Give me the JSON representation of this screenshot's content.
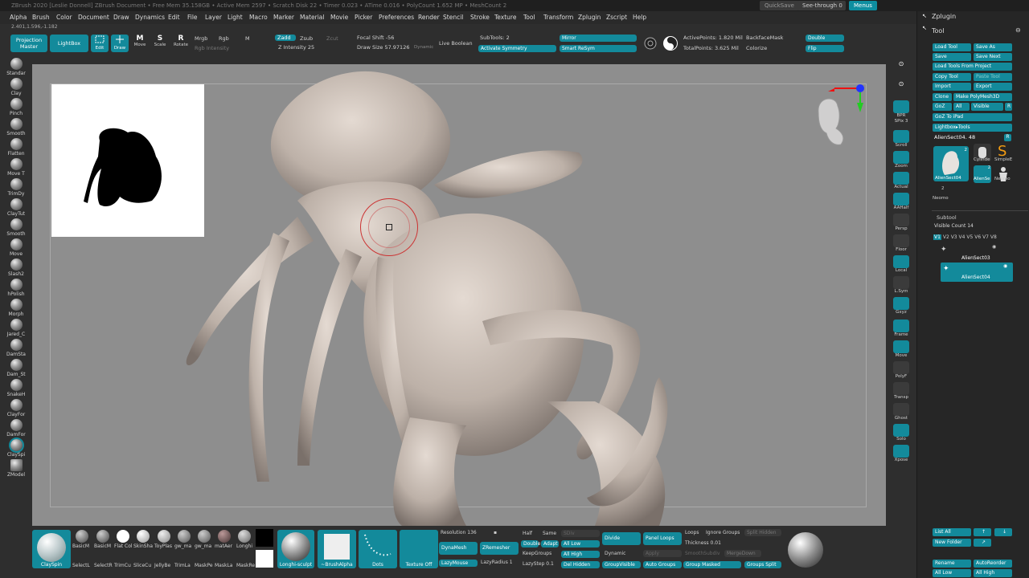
{
  "titlebar": {
    "text": "ZBrush 2020 [Leslie Donnell] ZBrush Document  •  Free Mem 35.158GB  •  Active Mem 2597  •  Scratch Disk 22  •  Timer 0.023  •  ATime 0.016  •  PolyCount 1.652 MP  •  MeshCount 2",
    "quicksave": "QuickSave",
    "see_through": "See-through",
    "see_through_value": "0",
    "menus": "Menus"
  },
  "menubar": [
    "Alpha",
    "Brush",
    "Color",
    "Document",
    "Draw",
    "Dynamics",
    "Edit",
    "File",
    "Layer",
    "Light",
    "Macro",
    "Marker",
    "Material",
    "Movie",
    "Picker",
    "Preferences",
    "Render",
    "Stencil",
    "Stroke",
    "Texture",
    "Tool",
    "Transform",
    "Zplugin",
    "Zscript",
    "Help"
  ],
  "coords": "2.401,1.596,-1.182",
  "toolbar": {
    "projection_master": "Projection Master",
    "lightbox": "LightBox",
    "edit": "Edit",
    "draw": "Draw",
    "move": "Move",
    "scale": "Scale",
    "rotate": "Rotate",
    "mrgb": "Mrgb",
    "rgb": "Rgb",
    "m": "M",
    "rgb_intensity": "Rgb Intensity",
    "zadd": "Zadd",
    "zsub": "Zsub",
    "zcut": "Zcut",
    "z_intensity": "Z Intensity 25",
    "focal_shift": "Focal Shift -56",
    "draw_size": "Draw Size 57.97126",
    "dynamic": "Dynamic",
    "live_boolean": "Live Boolean",
    "subtools": "SubTools: 2",
    "activate_symmetry": "Activate Symmetry",
    "mirror": "Mirror",
    "smart_resym": "Smart ReSym",
    "active_points": "ActivePoints: 1.820 Mil",
    "total_points": "TotalPoints: 3.625 Mil",
    "backface_mask": "BackfaceMask",
    "colorize": "Colorize",
    "double": "Double",
    "flip": "Flip"
  },
  "left_brushes": [
    "Standar",
    "Clay",
    "Pinch",
    "Smooth",
    "Flatten",
    "Move T",
    "TrimDy",
    "ClayTut",
    "Smooth",
    "Move",
    "Slash2",
    "hPolish",
    "Morph",
    "Jared_C",
    "DamSta",
    "Dam_St",
    "SnakeH",
    "ClayFor",
    "DamFor",
    "ClaySpi",
    "ZModel"
  ],
  "right_shelf": [
    "BPR",
    "SPix 3",
    "Scroll",
    "Zoom",
    "Actual",
    "AAHalf",
    "Persp",
    "Floor",
    "Local",
    "L.Sym",
    "Gxyz",
    "",
    "Frame",
    "Move",
    "Zoom3D",
    "PolyF",
    "Transp",
    "Ghost",
    "Solo",
    "Xpose"
  ],
  "tray": {
    "zplugin": "Zplugin",
    "tool": "Tool",
    "buttons": [
      [
        "Load Tool",
        "Save As"
      ],
      [
        "Save",
        "Save Next"
      ],
      [
        "Load Tools From Project"
      ],
      [
        "Copy Tool",
        "Paste Tool"
      ],
      [
        "Import",
        "Export"
      ],
      [
        "Clone",
        "Make PolyMesh3D"
      ],
      [
        "GoZ",
        "All",
        "Visible",
        "R"
      ],
      [
        "GoZ To iPad"
      ],
      [
        "Lightbox▸Tools"
      ]
    ],
    "current_tool": "AlienSect04. 48",
    "r_label": "R",
    "thumb_labels": [
      "AlienSect04",
      "Cylinde",
      "SimpleE",
      "AlienSe",
      "Neomo",
      "Neomo"
    ],
    "thumb_counts": [
      "2",
      "2",
      "2"
    ],
    "subtool": "Subtool",
    "visible_count": "Visible Count 14",
    "versions": [
      "V1",
      "V2",
      "V3",
      "V4",
      "V5",
      "V6",
      "V7",
      "V8"
    ],
    "subtools": [
      "AlienSect03",
      "AlienSect04"
    ],
    "bottom_buttons": [
      [
        "List All",
        "↑",
        "↓"
      ],
      [
        "New Folder",
        "↗"
      ],
      [
        "Rename",
        "AutoReorder"
      ],
      [
        "All Low",
        "All High"
      ]
    ]
  },
  "bottom": {
    "current_brush": "ClaySpin",
    "brushes": [
      "BasicM",
      "BasicM",
      "Flat Col",
      "SkinSha",
      "ToyPlas",
      "gw_ma",
      "gw_ma",
      "matAer",
      "Longhi"
    ],
    "brushes2": [
      "SelectL",
      "SelectR",
      "TrimCu",
      "SliceCu",
      "JellyBe",
      "TrimLa",
      "MaskPe",
      "MaskLa",
      "MaskRe"
    ],
    "material": "Longhi-sculpt",
    "alpha": "~BrushAlpha",
    "stroke": "Dots",
    "texture": "Texture Off",
    "resolution": "Resolution 136",
    "dynamesh": "DynaMesh",
    "zremesher": "ZRemesher",
    "lazymouse": "LazyMouse",
    "lazyradius": "LazyRadius 1",
    "half": "Half",
    "same": "Same",
    "double": "Double",
    "adapt": "Adapt",
    "keepgroups": "KeepGroups",
    "lazystep": "LazyStep 0.1",
    "sdiv": "SDiv",
    "all_low": "All Low",
    "all_high": "All High",
    "del_hidden": "Del Hidden",
    "divide": "Divide",
    "dynamic": "Dynamic",
    "apply": "Apply",
    "groupvisible": "GroupVisible",
    "panel_loops": "Panel Loops",
    "auto_groups": "Auto Groups",
    "loops": "Loops",
    "ignore_groups": "Ignore Groups",
    "split_hidden": "Split Hidden",
    "thickness": "Thickness 0.01",
    "smoothsubdiv": "SmoothSubdiv",
    "mergedown": "MergeDown",
    "group_masked": "Group Masked",
    "groups_split": "Groups Split"
  },
  "colors": {
    "accent": "#138a9b",
    "canvas": "#8e8e8e",
    "sculpt": "#d6cbc3"
  }
}
